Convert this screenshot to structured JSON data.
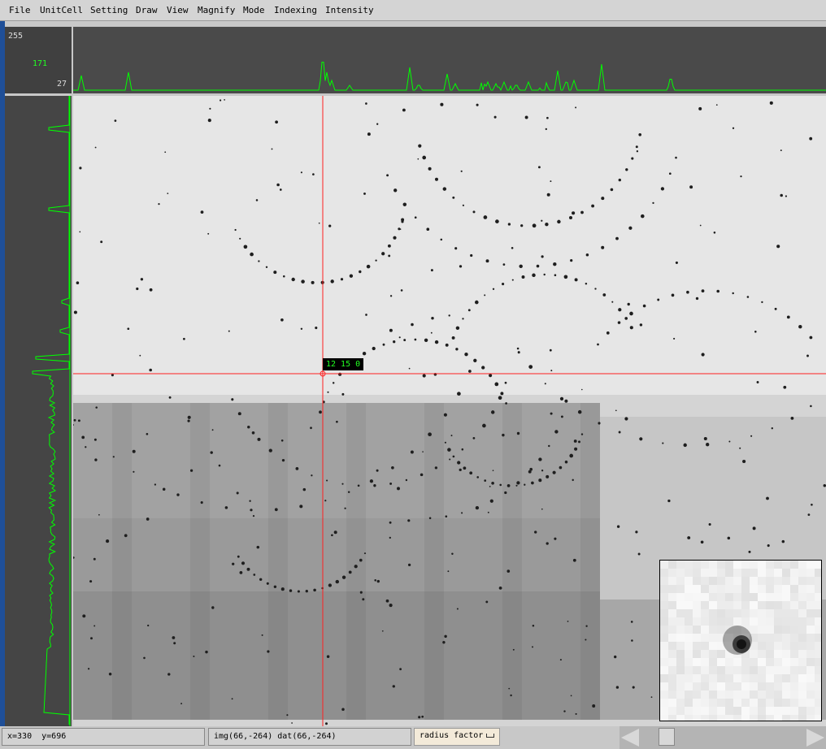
{
  "menu": [
    "File",
    "UnitCell",
    "Setting",
    "Draw",
    "View",
    "Magnify",
    "Mode",
    "Indexing",
    "Intensity"
  ],
  "profile_scale": {
    "max": "255",
    "mid": "171",
    "min": "27"
  },
  "cursor_hkl": "12 15 0",
  "status": {
    "xy": "x=330  y=696",
    "img_dat": "img(66,-264) dat(66,-264)",
    "radius_label": "radius factor"
  },
  "colors": {
    "profile": "#00ff00",
    "crosshair": "#ff2020",
    "hkl_text": "#22ff22",
    "left_strip": "#1f4f98"
  }
}
